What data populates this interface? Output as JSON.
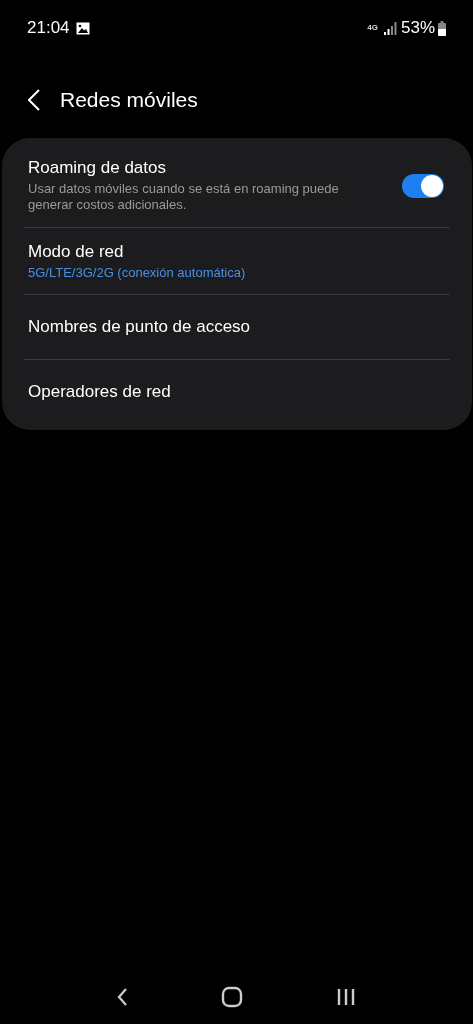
{
  "status_bar": {
    "time": "21:04",
    "network": "4G",
    "battery": "53%"
  },
  "header": {
    "title": "Redes móviles"
  },
  "items": [
    {
      "kind": "toggle",
      "title": "Roaming de datos",
      "summary": "Usar datos móviles cuando se está en roaming puede generar costos adicionales.",
      "on": true
    },
    {
      "kind": "value",
      "title": "Modo de red",
      "value": "5G/LTE/3G/2G (conexión automática)"
    },
    {
      "kind": "plain",
      "title": "Nombres de punto de acceso"
    },
    {
      "kind": "plain",
      "title": "Operadores de red"
    }
  ]
}
